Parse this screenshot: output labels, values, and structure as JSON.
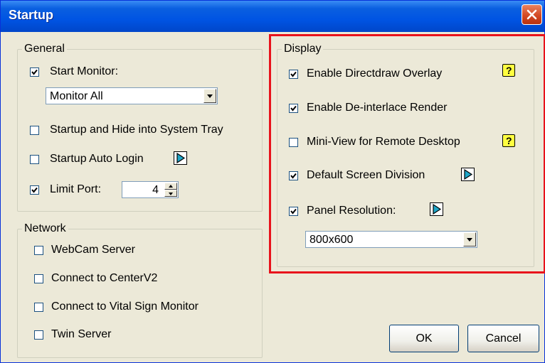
{
  "window": {
    "title": "Startup"
  },
  "general": {
    "legend": "General",
    "start_monitor": {
      "label": "Start Monitor:",
      "checked": true
    },
    "monitor_select": {
      "value": "Monitor All"
    },
    "hide_tray": {
      "label": "Startup and Hide into System Tray",
      "checked": false
    },
    "auto_login": {
      "label": "Startup Auto Login",
      "checked": false
    },
    "limit_port": {
      "label": "Limit Port:",
      "checked": true,
      "value": "4"
    }
  },
  "network": {
    "legend": "Network",
    "items": [
      {
        "label": "WebCam Server",
        "checked": false
      },
      {
        "label": "Connect to CenterV2",
        "checked": false
      },
      {
        "label": "Connect to Vital Sign Monitor",
        "checked": false
      },
      {
        "label": "Twin Server",
        "checked": false
      }
    ]
  },
  "display": {
    "legend": "Display",
    "directdraw": {
      "label": "Enable Directdraw Overlay",
      "checked": true
    },
    "deinterlace": {
      "label": "Enable De-interlace Render",
      "checked": true
    },
    "miniview": {
      "label": "Mini-View for Remote Desktop",
      "checked": false
    },
    "screen_division": {
      "label": "Default Screen Division",
      "checked": true
    },
    "panel_resolution": {
      "label": "Panel Resolution:",
      "checked": true,
      "value": "800x600"
    }
  },
  "buttons": {
    "ok": "OK",
    "cancel": "Cancel"
  },
  "icons": {
    "help": "?",
    "close": "close-icon",
    "arrow": "play-arrow-icon"
  },
  "colors": {
    "title_bar": "#0054e3",
    "highlight": "#e8121b",
    "help_icon": "#ffff40",
    "arrow_icon": "#1fa6c8"
  }
}
